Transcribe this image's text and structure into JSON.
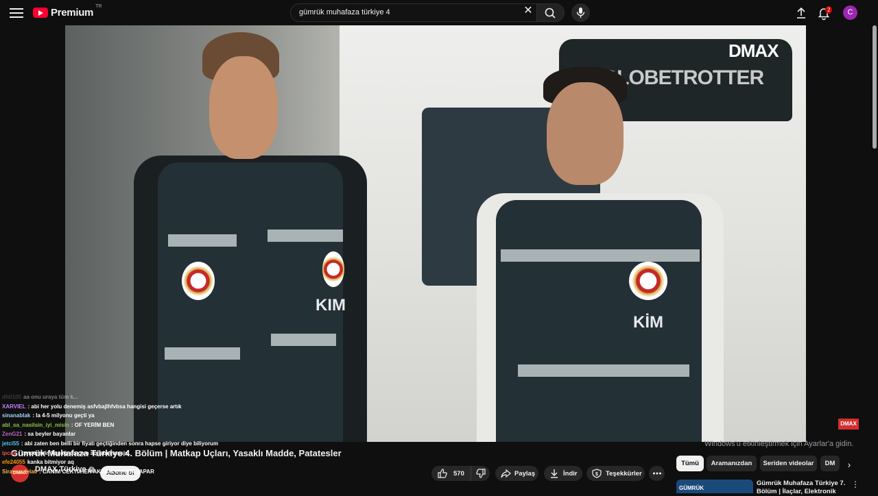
{
  "header": {
    "logo_text": "Premium",
    "logo_country": "TR",
    "search_value": "gümrük muhafaza türkiye 4",
    "notification_count": "2",
    "avatar_letter": "C"
  },
  "player": {
    "brand_watermark": "DMAX",
    "brand_corner": "DMAX",
    "truck_text": "GLOBETROTTER",
    "vest_text_left": "KIM",
    "vest_text_right": "KİM",
    "windows_notice": "Windows'u etkinleştirmek için Ayarlar'a gidin."
  },
  "chat": [
    {
      "user": "dfdl105",
      "msg": "aa onu uraya tüm k...",
      "color": "#6b6b6b"
    },
    {
      "user": "XARVIEL",
      "msg": ": abi her yolu denemiş asfvbajlhfvbsa hangisi geçerse artık",
      "color": "#c77dff"
    },
    {
      "user": "sinanablak",
      "msg": ": la 4-5 milyonu geçti ya",
      "color": "#9fd3ff"
    },
    {
      "user": "abl_sa_nasilsin_iyi_misin",
      "msg": ": OF YERİM BEN",
      "color": "#8bc34a"
    },
    {
      "user": "ZenG21",
      "msg": ": sa beyler bayanlar",
      "color": "#ba68c8"
    },
    {
      "user": "jetci55",
      "msg": ": abi zaten ben belli bir fiyatı geçtiğinden sonra hapse giriyor diye biliyorum",
      "color": "#4fc3f7"
    },
    {
      "user": "ipcan",
      "msg": ": tencerenin kapağı da cam aq lsbslhsşsjs",
      "color": "#ef5350"
    },
    {
      "user": "efe24055",
      "msg": "kanka bitmiyor aq",
      "color": "#ff9800"
    },
    {
      "user": "Sirawendela0",
      "msg": ": CANIM CEKTI HER AKSAM ANNEM YAPAR",
      "color": "#ffb74d"
    }
  ],
  "video": {
    "title": "Gümrük Muhafaza Türkiye 4. Bölüm | Matkap Uçları, Yasaklı Madde, Patatesler",
    "channel_name": "DMAX Türkiye",
    "channel_avatar_text": "DMAX",
    "subscribe_label": "Abone ol",
    "like_count": "570",
    "share_label": "Paylaş",
    "download_label": "İndir",
    "thanks_label": "Teşekkürler"
  },
  "chips": [
    "Tümü",
    "Aramanızdan",
    "Seriden videolar",
    "DM"
  ],
  "recommendation": {
    "thumb_text": "GÜMRÜK",
    "title": "Gümrük Muhafaza Türkiye 7. Bölüm | İlaçlar, Elektronik"
  }
}
